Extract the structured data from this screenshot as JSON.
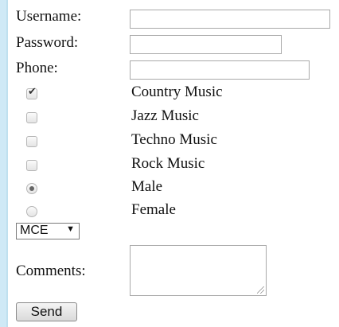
{
  "form": {
    "username_label": "Username:",
    "username_value": "",
    "password_label": "Password:",
    "password_value": "",
    "phone_label": "Phone:",
    "phone_value": "",
    "checkboxes": [
      {
        "label": "Country Music",
        "checked": true
      },
      {
        "label": "Jazz Music",
        "checked": false
      },
      {
        "label": "Techno Music",
        "checked": false
      },
      {
        "label": "Rock Music",
        "checked": false
      }
    ],
    "radios": [
      {
        "label": "Male",
        "selected": true
      },
      {
        "label": "Female",
        "selected": false
      }
    ],
    "select_value": "MCE",
    "select_arrow": "▼",
    "comments_label": "Comments:",
    "comments_value": "",
    "send_label": "Send"
  },
  "colors": {
    "page_background": "#cfe9f6",
    "panel_background": "#ffffff",
    "field_border": "#a9a9a9"
  },
  "icons": {
    "checkbox_tick": "check-icon",
    "radio_dot": "radio-dot-icon",
    "dropdown_arrow": "chevron-down-icon",
    "textarea_grip": "resize-grip-icon"
  }
}
